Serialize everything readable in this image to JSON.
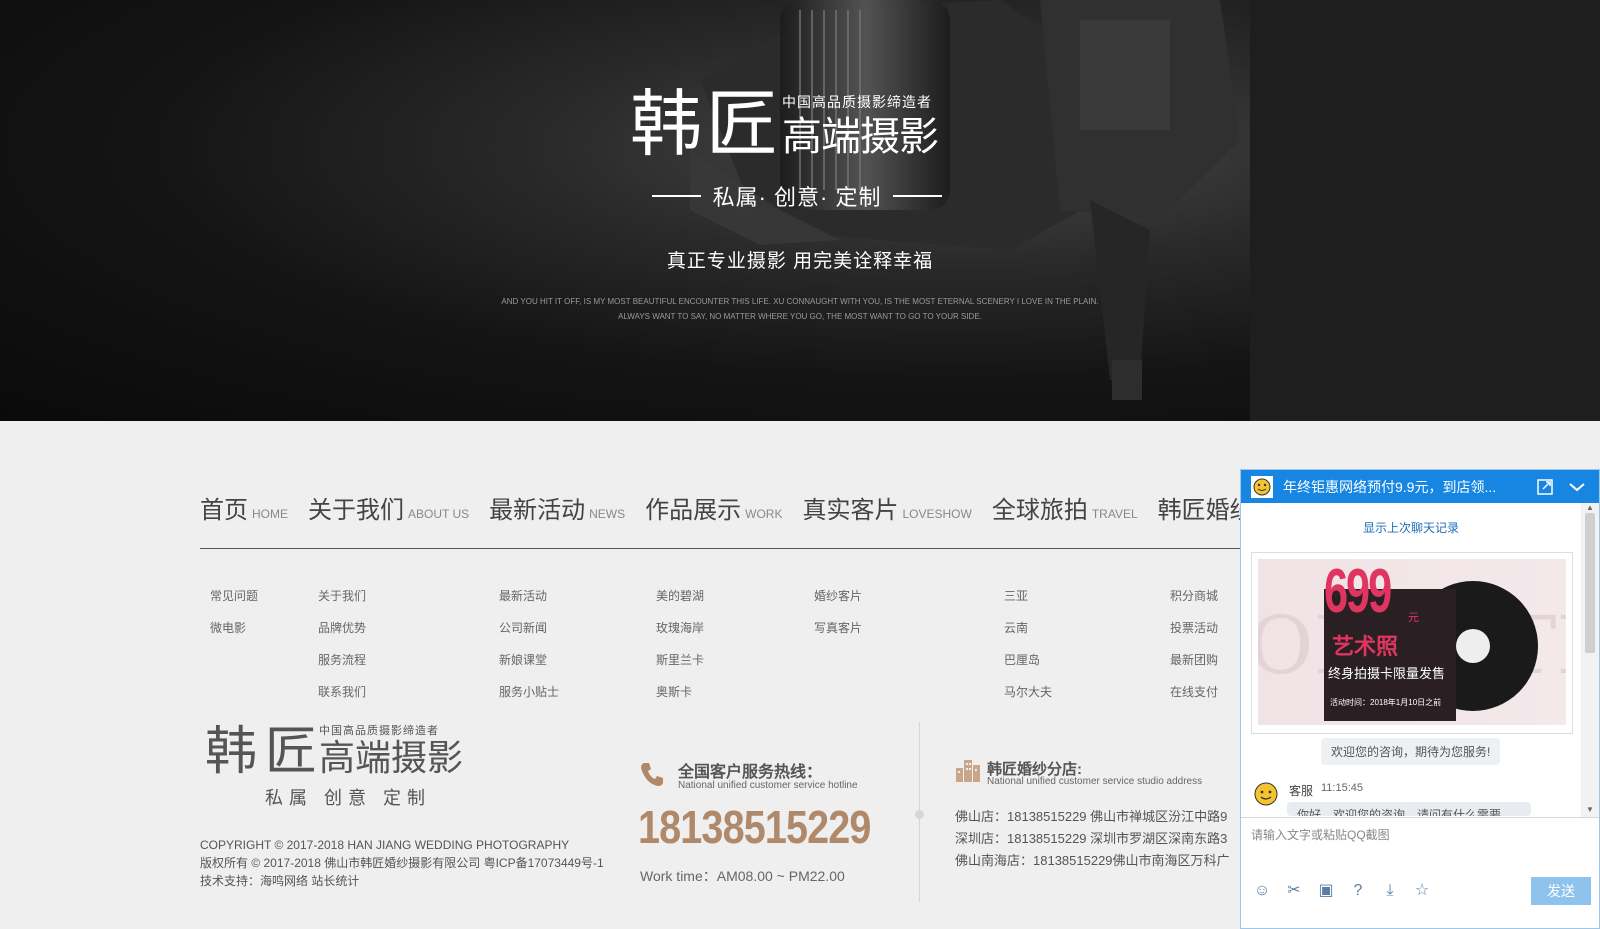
{
  "hero": {
    "brand_han": "韩",
    "brand_jiang": "匠",
    "brand_sub": "中国高品质摄影缔造者",
    "brand_gaoduan": "高端摄影",
    "brand_tagline": "私属· 创意· 定制",
    "slogan": "真正专业摄影 用完美诠释幸福",
    "en_line1": "AND YOU HIT IT OFF, IS MY MOST BEAUTIFUL ENCOUNTER THIS LIFE. XU CONNAUGHT WITH YOU, IS THE MOST ETERNAL SCENERY I LOVE IN THE PLAIN.",
    "en_line2": "ALWAYS WANT TO SAY, NO MATTER WHERE YOU GO, THE MOST WANT TO GO TO YOUR SIDE."
  },
  "nav": [
    {
      "cn": "首页",
      "en": "HOME"
    },
    {
      "cn": "关于我们",
      "en": "ABOUT US"
    },
    {
      "cn": "最新活动",
      "en": "NEWS"
    },
    {
      "cn": "作品展示",
      "en": "WORK"
    },
    {
      "cn": "真实客片",
      "en": "LOVESHOW"
    },
    {
      "cn": "全球旅拍",
      "en": "TRAVEL"
    },
    {
      "cn": "韩匠婚纱",
      "en": ""
    }
  ],
  "submenu": {
    "col0": [
      "常见问题",
      "微电影"
    ],
    "col1": [
      "关于我们",
      "品牌优势",
      "服务流程",
      "联系我们"
    ],
    "col2": [
      "最新活动",
      "公司新闻",
      "新娘课堂",
      "服务小贴士"
    ],
    "col3": [
      "美的碧湖",
      "玫瑰海岸",
      "斯里兰卡",
      "奥斯卡"
    ],
    "col4": [
      "婚纱客片",
      "写真客片"
    ],
    "col5": [
      "三亚",
      "云南",
      "巴厘岛",
      "马尔大夫"
    ],
    "col6": [
      "积分商城",
      "投票活动",
      "最新团购",
      "在线支付"
    ]
  },
  "footer": {
    "logo_han": "韩",
    "logo_jiang": "匠",
    "logo_sub": "中国高品质摄影缔造者",
    "logo_gaoduan": "高端摄影",
    "logo_tag": "私属 创意 定制",
    "copyright_en": "COPYRIGHT © 2017-2018 HAN JIANG WEDDING PHOTOGRAPHY",
    "copyright_cn": "版权所有 © 2017-2018 佛山市韩匠婚纱摄影有限公司 粤ICP备17073449号-1",
    "tech": "技术支持：海鸣网络 站长统计",
    "hotline_title": "全国客户服务热线：",
    "hotline_en": "National unified customer service hotline",
    "phone": "18138515229",
    "work_time": "Work time：AM08.00 ~ PM22.00",
    "stores_title": "韩匠婚纱分店:",
    "stores_en": "National unified customer service studio address",
    "stores": [
      "佛山店：18138515229  佛山市禅城区汾江中路9",
      "深圳店：18138515229  深圳市罗湖区深南东路3",
      "佛山南海店：18138515229佛山市南海区万科广"
    ]
  },
  "chat": {
    "title": "年终钜惠网络预付9.9元，到店领...",
    "history_link": "显示上次聊天记录",
    "promo_price": "699",
    "promo_yuan": "元",
    "promo_art": "艺术照",
    "promo_life": "终身拍摄卡限量发售",
    "promo_time": "活动时间：2018年1月10日之前",
    "welcome": "欢迎您的咨询，期待为您服务!",
    "sender": "客服",
    "msg_time": "11:15:45",
    "msg_preview": "你好，欢迎您的咨询，请问有什么需要",
    "input_placeholder": "请输入文字或粘贴QQ截图",
    "send_label": "发送"
  }
}
